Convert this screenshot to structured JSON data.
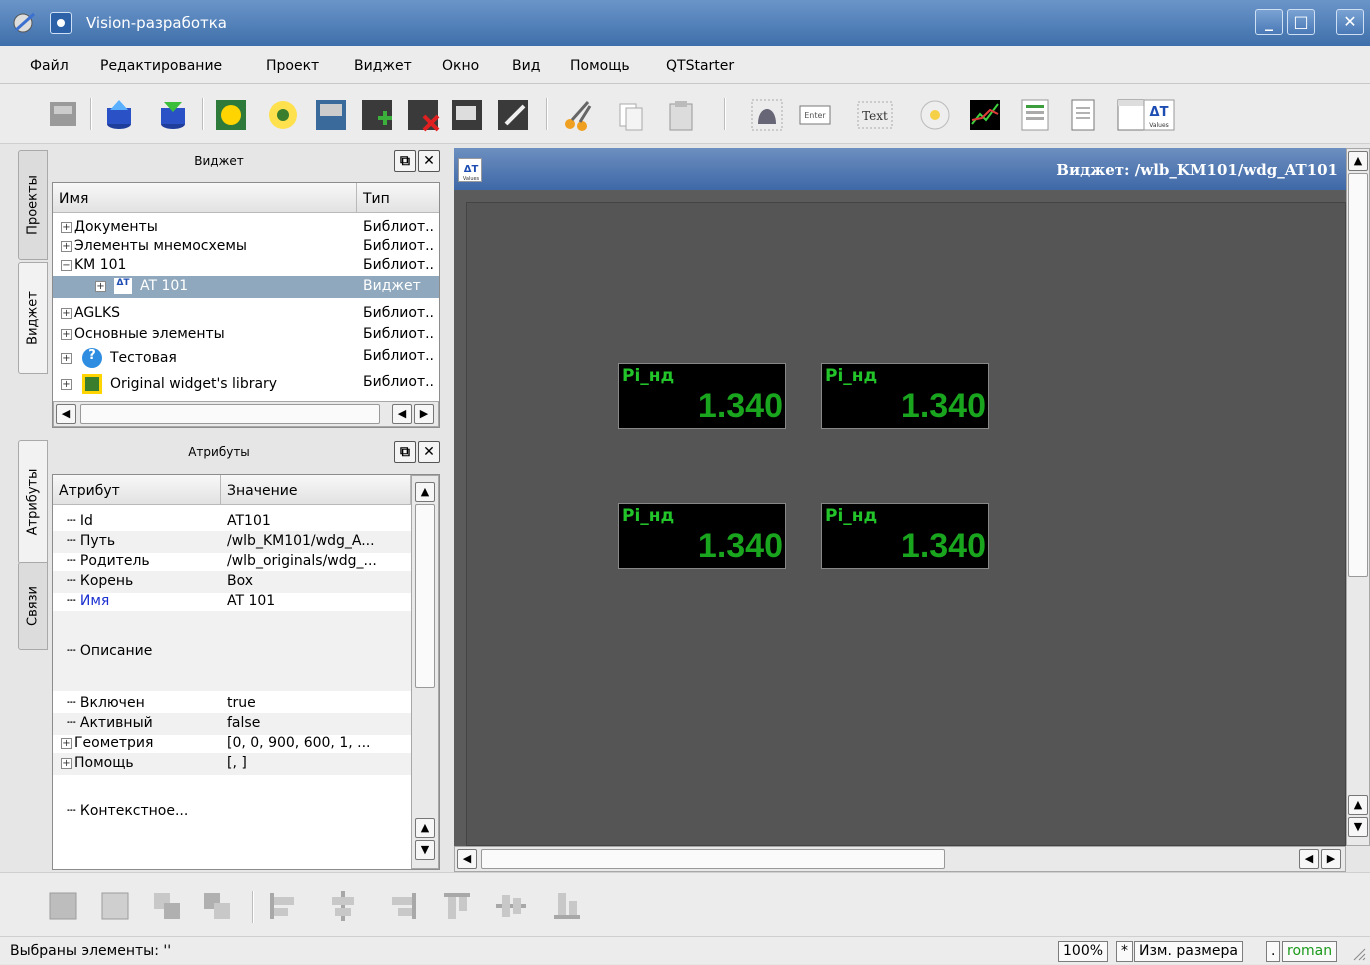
{
  "window": {
    "title": "Vision-разработка",
    "controls": {
      "minimize": "_",
      "maximize": "□",
      "close": "✕"
    }
  },
  "menu": [
    "Файл",
    "Редактирование",
    "Проект",
    "Виджет",
    "Окно",
    "Вид",
    "Помощь",
    "QTStarter"
  ],
  "toolbar": {
    "enter_label": "Enter",
    "text_label": "Text",
    "value_label": "Values",
    "value_symbol": "ΔT"
  },
  "side_tabs_top": [
    "Проекты",
    "Виджет"
  ],
  "side_tabs_bottom": [
    "Атрибуты",
    "Связи"
  ],
  "widget_dock": {
    "title": "Виджет",
    "columns": [
      "Имя",
      "Тип"
    ],
    "rows": [
      {
        "name": "Документы",
        "type": "Библиот.."
      },
      {
        "name": "Элементы мнемосхемы",
        "type": "Библиот.."
      },
      {
        "name": "KM 101",
        "type": "Библиот.."
      },
      {
        "name": "AT 101",
        "type": "Виджет"
      },
      {
        "name": "AGLKS",
        "type": "Библиот.."
      },
      {
        "name": "Основные элементы",
        "type": "Библиот.."
      },
      {
        "name": "Тестовая",
        "type": "Библиот.."
      },
      {
        "name": "Original widget's library",
        "type": "Библиот.."
      }
    ]
  },
  "attr_dock": {
    "title": "Атрибуты",
    "columns": [
      "Атрибут",
      "Значение"
    ],
    "rows": [
      {
        "name": "Id",
        "value": "AT101"
      },
      {
        "name": "Путь",
        "value": "/wlb_KM101/wdg_A..."
      },
      {
        "name": "Родитель",
        "value": "/wlb_originals/wdg_..."
      },
      {
        "name": "Корень",
        "value": "Box"
      },
      {
        "name": "Имя",
        "value": "AT 101"
      },
      {
        "name": "Описание",
        "value": ""
      },
      {
        "name": "Включен",
        "value": "true"
      },
      {
        "name": "Активный",
        "value": "false"
      },
      {
        "name": "Геометрия",
        "value": "[0, 0, 900, 600, 1, ..."
      },
      {
        "name": "Помощь",
        "value": "[, ]"
      },
      {
        "name": "Контекстное...",
        "value": ""
      }
    ]
  },
  "subwindow": {
    "title": "Виджет: /wlb_KM101/wdg_AT101",
    "icon_symbol": "ΔT",
    "icon_label": "Values"
  },
  "widgets": [
    {
      "label": "Pi_нд",
      "value": "1.340"
    },
    {
      "label": "Pi_нд",
      "value": "1.340"
    },
    {
      "label": "Pi_нд",
      "value": "1.340"
    },
    {
      "label": "Pi_нд",
      "value": "1.340"
    }
  ],
  "status": {
    "selected": "Выбраны элементы: ''",
    "zoom": "100%",
    "modified": "*",
    "resize": "Изм. размера",
    "dot": ".",
    "user": "roman"
  },
  "colors": {
    "titlebar": "#4a7bb8",
    "selection": "#8fa8bd",
    "widget_text": "#22c42a",
    "canvas": "#555555"
  }
}
